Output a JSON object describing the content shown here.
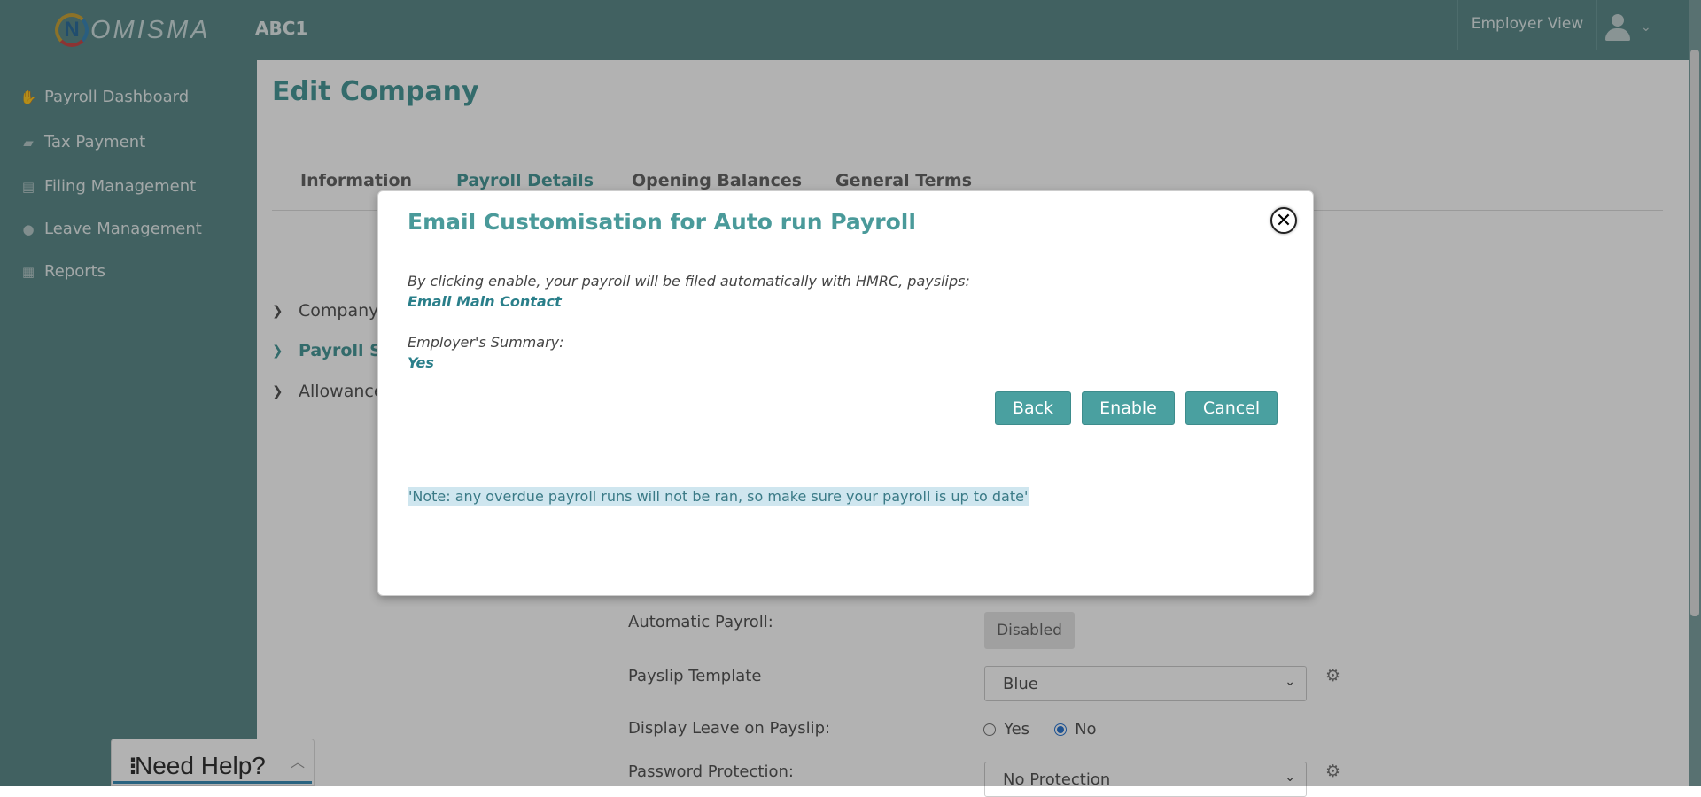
{
  "header": {
    "logo_letter": "N",
    "logo_text": "OMISMA",
    "company": "ABC1",
    "employer_view": "Employer View"
  },
  "sidebar": {
    "items": [
      {
        "label": "Payroll Dashboard",
        "icon": "hand-money-icon"
      },
      {
        "label": "Tax Payment",
        "icon": "briefcase-icon"
      },
      {
        "label": "Filing Management",
        "icon": "document-icon"
      },
      {
        "label": "Leave Management",
        "icon": "globe-icon"
      },
      {
        "label": "Reports",
        "icon": "clipboard-icon"
      }
    ]
  },
  "page": {
    "title": "Edit Company",
    "tabs": [
      "Information",
      "Payroll Details",
      "Opening Balances",
      "General Terms"
    ],
    "active_tab": "Payroll Details",
    "sections": [
      "Company D",
      "Payroll Set",
      "Allowances"
    ]
  },
  "form": {
    "automatic_payroll_label": "Automatic Payroll:",
    "automatic_payroll_value": "Disabled",
    "payslip_template_label": "Payslip Template",
    "payslip_template_value": "Blue",
    "display_leave_label": "Display Leave on Payslip:",
    "radio_yes": "Yes",
    "radio_no": "No",
    "display_leave_selected": "No",
    "password_protection_label": "Password Protection:",
    "password_protection_value": "No Protection"
  },
  "help": {
    "label": "Need Help?"
  },
  "modal": {
    "title": "Email Customisation for Auto run Payroll",
    "close_symbol": "✕",
    "line1": "By clicking enable, your payroll will be filed automatically with HMRC, payslips:",
    "payslips_value": "Email Main Contact",
    "line2": "Employer's Summary:",
    "summary_value": "Yes",
    "back_label": "Back",
    "enable_label": "Enable",
    "cancel_label": "Cancel",
    "note": "'Note: any overdue payroll runs will not be ran, so make sure your payroll is up to date'"
  },
  "colors": {
    "sidebar": "#5d8b8b",
    "accent": "#4a9a9a",
    "button": "#4aa0a0"
  }
}
